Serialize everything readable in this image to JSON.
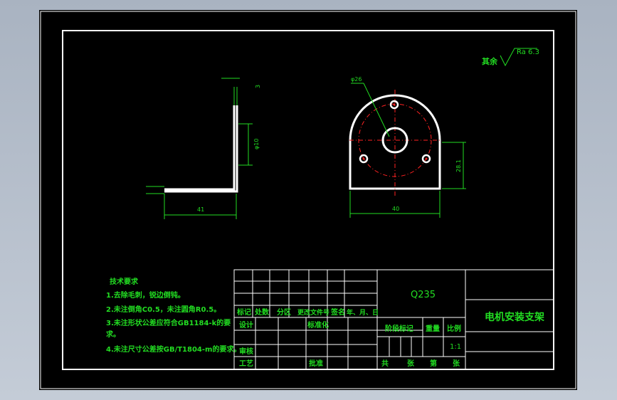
{
  "drawing": {
    "roughness": {
      "prefix": "其余",
      "value": "Ra 6.3"
    },
    "dimensions": {
      "side_thickness": "3",
      "side_hole": "φ10",
      "side_width": "41",
      "front_hole_dia": "φ26",
      "front_width": "40",
      "front_height": "28.1"
    },
    "notes": {
      "title": "技术要求",
      "items": [
        "1.去除毛刺，锐边倒钝。",
        "2.未注倒角C0.5，未注圆角R0.5。",
        "3.未注形状公差应符合GB1184-k的要",
        "求。",
        "4.未注尺寸公差按GB/T1804-m的要求。"
      ]
    },
    "title_block": {
      "material": "Q235",
      "part_name": "电机安装支架",
      "change_labels": [
        "标记",
        "处数",
        "分区",
        "更改文件号",
        "签名",
        "年、月、日"
      ],
      "design": "设计",
      "standardize": "标准化",
      "review": "审核",
      "process": "工艺",
      "approve": "批准",
      "stage_mark": "阶段标记",
      "weight": "重量",
      "scale_label": "比例",
      "scale_value": "1:1",
      "sheets_total": "共",
      "sheet_unit": "张",
      "sheet_no": "第",
      "sheet_unit2": "张"
    }
  }
}
